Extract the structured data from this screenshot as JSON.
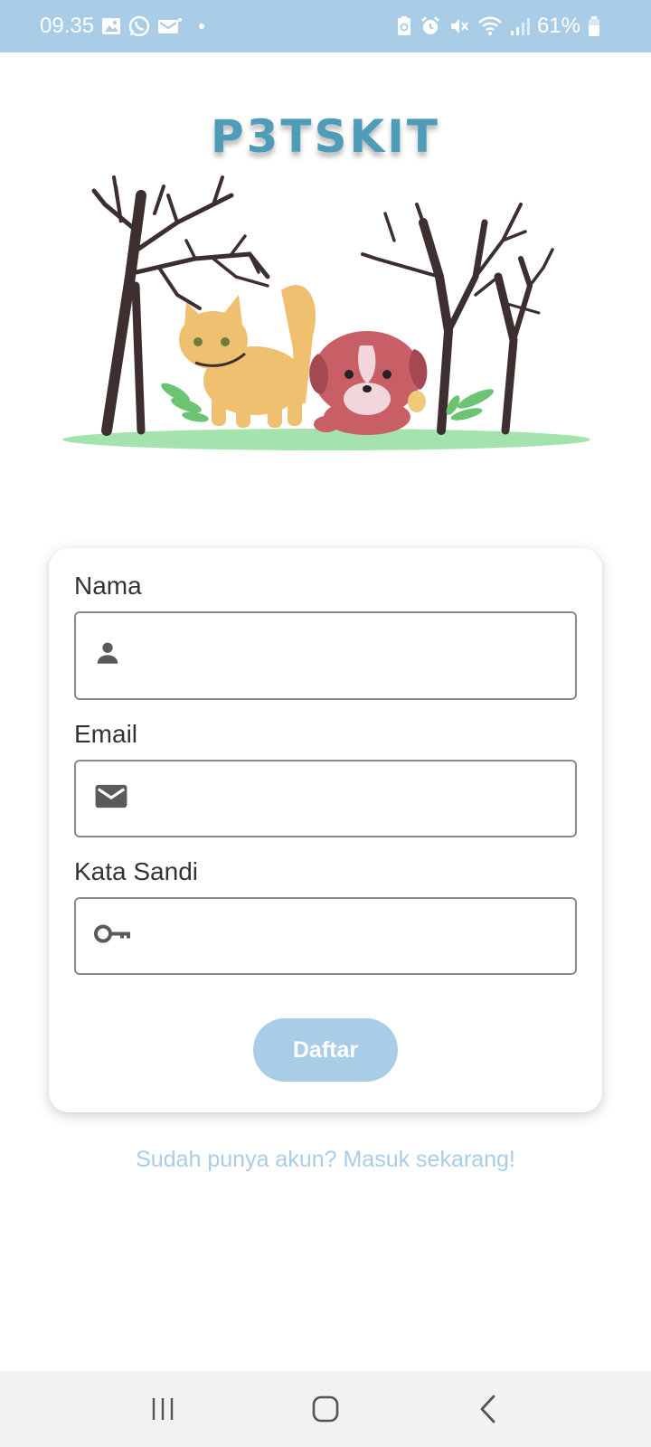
{
  "status_bar": {
    "time": "09.35",
    "battery": "61%",
    "left_icons": [
      "gallery-icon",
      "whatsapp-icon",
      "message-icon"
    ],
    "right_icons": [
      "battery-saver-icon",
      "alarm-icon",
      "mute-icon",
      "wifi-icon",
      "signal-icon",
      "battery-icon"
    ]
  },
  "app": {
    "logo": "P3TSKIT"
  },
  "form": {
    "name_label": "Nama",
    "name_value": "",
    "email_label": "Email",
    "email_value": "",
    "password_label": "Kata Sandi",
    "password_value": "",
    "submit_label": "Daftar"
  },
  "footer": {
    "login_link": "Sudah punya akun? Masuk sekarang!"
  },
  "nav": {
    "buttons": [
      "recent-apps-icon",
      "home-icon",
      "back-icon"
    ]
  },
  "colors": {
    "accent": "#a9cde6",
    "logo": "#4e9cb8",
    "text": "#333333",
    "border": "#8a8a8a"
  }
}
